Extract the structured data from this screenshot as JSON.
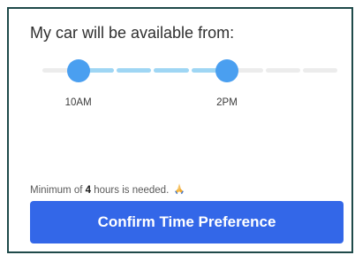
{
  "title": "My car will be available from:",
  "slider": {
    "segments": 8,
    "start_index": 1,
    "end_index": 5,
    "start_label": "10AM",
    "end_label": "2PM"
  },
  "note": {
    "prefix": "Minimum of ",
    "hours": "4",
    "suffix": " hours is needed.",
    "emoji_icon": "praying-hands-icon"
  },
  "confirm_label": "Confirm Time Preference",
  "colors": {
    "accent": "#3367e8",
    "handle": "#4a9ff0",
    "track_active": "#9fd6f4",
    "track_inactive": "#ececec"
  }
}
